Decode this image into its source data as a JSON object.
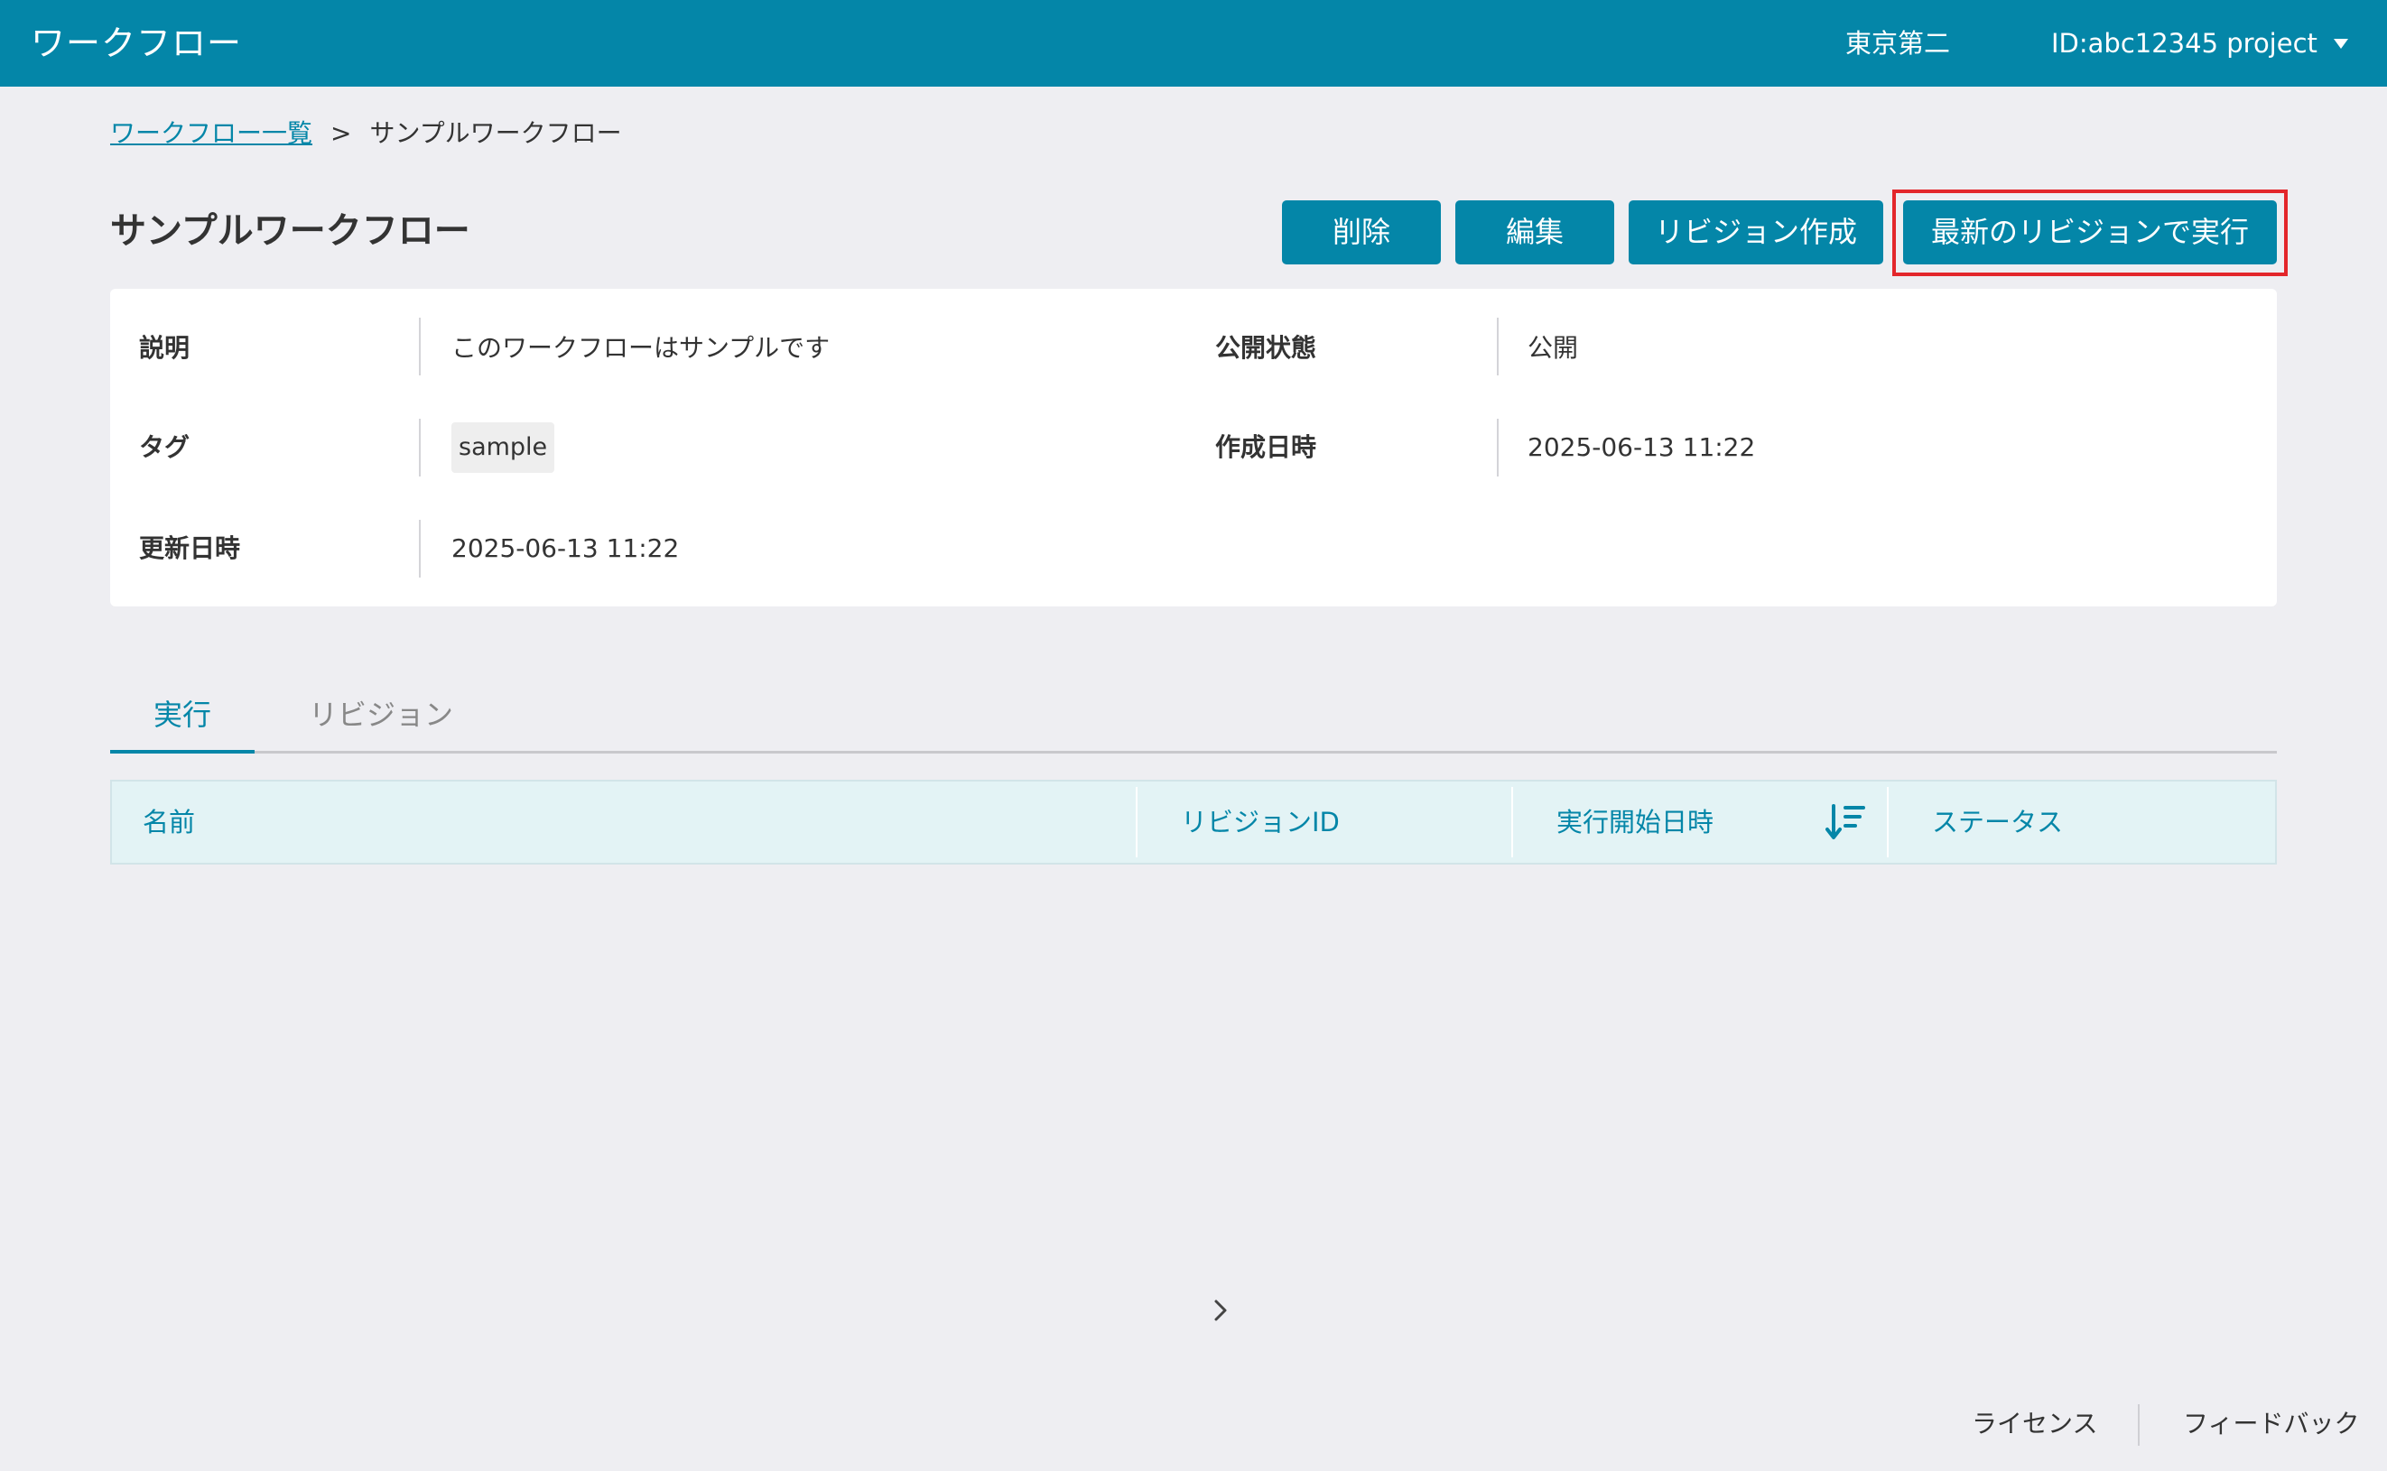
{
  "header": {
    "app_title": "ワークフロー",
    "org_name": "東京第二",
    "project_label": "ID:abc12345 project"
  },
  "breadcrumb": {
    "parent_label": "ワークフロー一覧",
    "separator": ">",
    "current_label": "サンプルワークフロー"
  },
  "page": {
    "title": "サンプルワークフロー"
  },
  "actions": {
    "delete_label": "削除",
    "edit_label": "編集",
    "create_revision_label": "リビジョン作成",
    "run_latest_label": "最新のリビジョンで実行"
  },
  "details": {
    "description_label": "説明",
    "description_value": "このワークフローはサンプルです",
    "visibility_label": "公開状態",
    "visibility_value": "公開",
    "tags_label": "タグ",
    "tags": [
      "sample"
    ],
    "created_label": "作成日時",
    "created_value": "2025-06-13 11:22",
    "updated_label": "更新日時",
    "updated_value": "2025-06-13 11:22"
  },
  "tabs": [
    {
      "label": "実行",
      "active": true
    },
    {
      "label": "リビジョン",
      "active": false
    }
  ],
  "table": {
    "columns": [
      "名前",
      "リビジョンID",
      "実行開始日時",
      "ステータス"
    ],
    "sort_column": "実行開始日時",
    "sort_direction": "descending",
    "rows": []
  },
  "footer": {
    "license_label": "ライセンス",
    "feedback_label": "フィードバック"
  },
  "colors": {
    "primary": "#0486a8",
    "highlight": "#e3262b",
    "background": "#eeeef2",
    "table_header_bg": "#e3f3f5"
  }
}
